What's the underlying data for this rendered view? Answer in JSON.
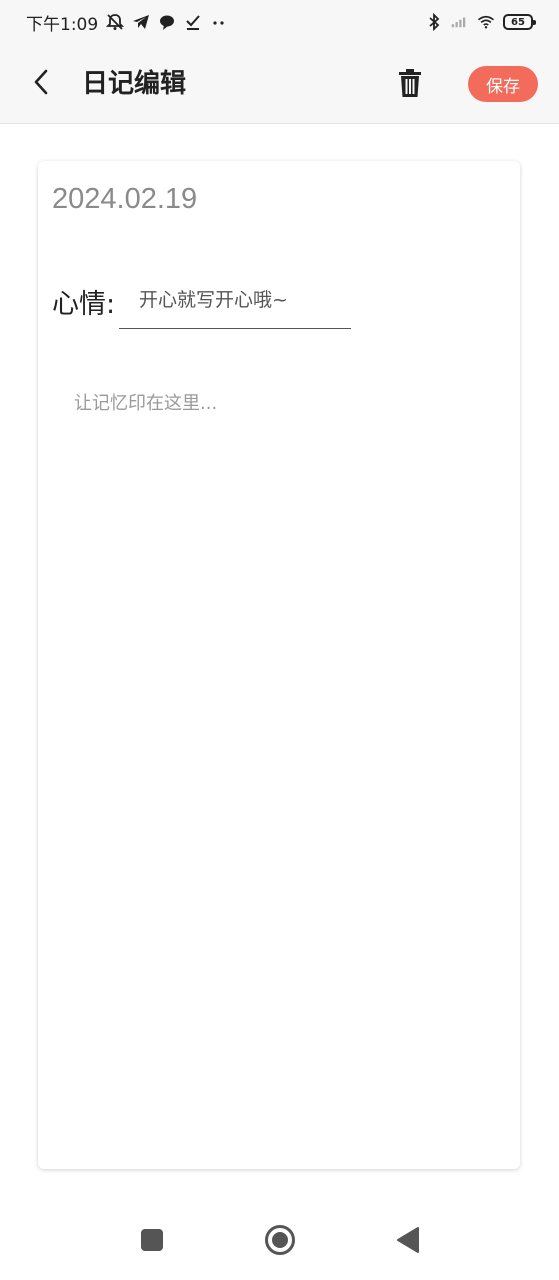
{
  "status_bar": {
    "time": "下午1:09",
    "battery": "65",
    "icons": [
      "mute-bell-icon",
      "telegram-icon",
      "chat-bubble-icon",
      "task-check-icon",
      "more-dots-icon",
      "bluetooth-icon",
      "signal-icon",
      "wifi-icon",
      "battery-icon"
    ]
  },
  "header": {
    "title": "日记编辑",
    "save_label": "保存",
    "icons": {
      "back": "chevron-left-icon",
      "delete": "trash-icon"
    }
  },
  "entry": {
    "date": "2024.02.19",
    "mood_label": "心情:",
    "mood_value": "",
    "mood_placeholder": "开心就写开心哦~",
    "content_value": "",
    "content_placeholder": "让记忆印在这里..."
  },
  "colors": {
    "accent": "#f26b5b",
    "app_bar_bg": "#f7f7f7",
    "date_text": "#8a8a8a"
  },
  "nav": {
    "icons": [
      "recents-square-icon",
      "home-circle-icon",
      "back-triangle-icon"
    ]
  }
}
